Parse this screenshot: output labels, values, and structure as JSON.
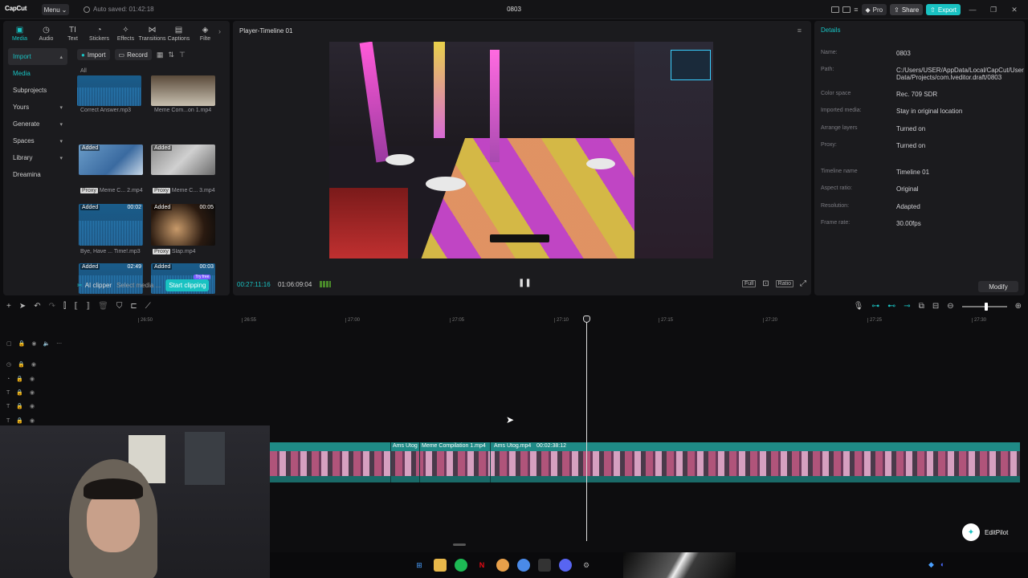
{
  "app": {
    "logo": "CapCut",
    "menu_label": "Menu",
    "autosave": "Auto saved: 01:42:18",
    "project_title": "0803",
    "pro_label": "Pro",
    "share_label": "Share",
    "export_label": "Export",
    "accent_color": "#19c2c2"
  },
  "media_panel": {
    "tabs": [
      {
        "label": "Media",
        "icon": "media-icon"
      },
      {
        "label": "Audio",
        "icon": "audio-icon"
      },
      {
        "label": "Text",
        "icon": "text-icon"
      },
      {
        "label": "Stickers",
        "icon": "stickers-icon"
      },
      {
        "label": "Effects",
        "icon": "effects-icon"
      },
      {
        "label": "Transitions",
        "icon": "transitions-icon"
      },
      {
        "label": "Captions",
        "icon": "captions-icon"
      },
      {
        "label": "Filte",
        "icon": "filters-icon"
      }
    ],
    "nav": [
      {
        "label": "Import",
        "active": true
      },
      {
        "label": "Media"
      },
      {
        "label": "Subprojects"
      },
      {
        "label": "Yours"
      },
      {
        "label": "Generate"
      },
      {
        "label": "Spaces"
      },
      {
        "label": "Library"
      },
      {
        "label": "Dreamina"
      }
    ],
    "import_btn": "Import",
    "record_btn": "Record",
    "all_label": "All",
    "items": [
      {
        "caption": "Correct Answer.mp3",
        "badge": "",
        "duration": "",
        "proxy": false
      },
      {
        "caption": "Meme Com...on 1.mp4",
        "badge": "",
        "duration": "",
        "proxy": false
      },
      {
        "caption": "Meme C... 2.mp4",
        "badge": "Added",
        "duration": "",
        "proxy": true
      },
      {
        "caption": "Meme C... 3.mp4",
        "badge": "Added",
        "duration": "",
        "proxy": true
      },
      {
        "caption": "Bye, Have ... Time!.mp3",
        "badge": "Added",
        "duration": "00:02",
        "proxy": false
      },
      {
        "caption": "Slap.mp4",
        "badge": "Added",
        "duration": "00:05",
        "proxy": true
      },
      {
        "caption": "",
        "badge": "Added",
        "duration": "02:49",
        "proxy": false
      },
      {
        "caption": "",
        "badge": "Added",
        "duration": "00:03",
        "proxy": false
      }
    ],
    "proxy_label": "Proxy",
    "ai_clipper": "AI clipper",
    "select_media": "Select media ...",
    "start_clipping": "Start clipping",
    "try_free": "Try free"
  },
  "player": {
    "title": "Player-Timeline 01",
    "current_time": "00:27:11:16",
    "total_time": "01:06:09:04",
    "full_label": "Full",
    "ratio_label": "Ratio"
  },
  "details": {
    "title": "Details",
    "rows": [
      {
        "k": "Name:",
        "v": "0803"
      },
      {
        "k": "Path:",
        "v": "C:/Users/USER/AppData/Local/CapCut/User Data/Projects/com.lveditor.draft/0803"
      },
      {
        "k": "Color space",
        "v": "Rec. 709 SDR"
      },
      {
        "k": "Imported media:",
        "v": "Stay in original location"
      },
      {
        "k": "Arrange layers",
        "v": "Turned on"
      },
      {
        "k": "Proxy:",
        "v": "Turned on"
      },
      {
        "k": "Timeline name",
        "v": "Timeline 01"
      },
      {
        "k": "Aspect ratio:",
        "v": "Original"
      },
      {
        "k": "Resolution:",
        "v": "Adapted"
      },
      {
        "k": "Frame rate:",
        "v": "30.00fps"
      }
    ],
    "modify_label": "Modify"
  },
  "timeline": {
    "ruler": [
      "26:50",
      "26:55",
      "27:00",
      "27:05",
      "27:10",
      "27:15",
      "27:20",
      "27:25",
      "27:30"
    ],
    "segments": [
      "Ams Utog",
      "Meme Compilation 1.mp4",
      "Ams Utog.mp4",
      "00:02:38:12"
    ]
  },
  "editpilot": {
    "label": "EditPilot"
  }
}
